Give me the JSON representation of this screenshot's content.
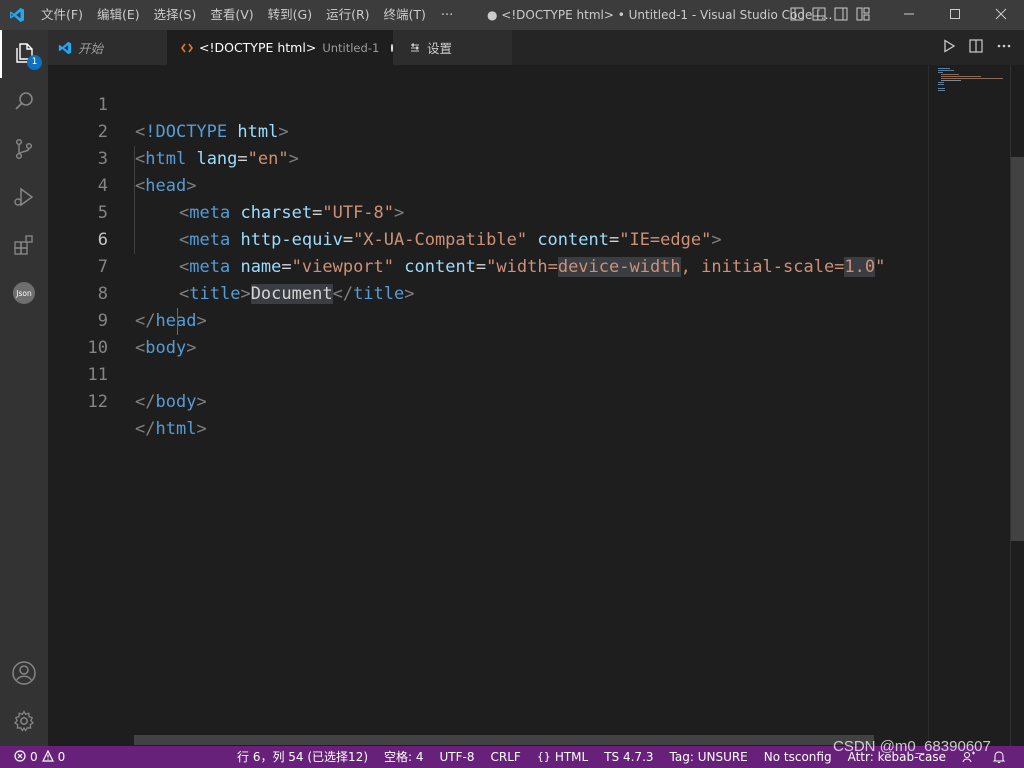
{
  "menu": [
    "文件(F)",
    "编辑(E)",
    "选择(S)",
    "查看(V)",
    "转到(G)",
    "运行(R)",
    "终端(T)"
  ],
  "menu_more": "···",
  "window_title": "● <!DOCTYPE html> • Untitled-1 - Visual Studio Code [...",
  "activity": {
    "explorer_badge": "1"
  },
  "tabs": [
    {
      "label": "开始",
      "icon": "vscode-icon"
    },
    {
      "label": "<!DOCTYPE html>",
      "description": "Untitled-1",
      "icon": "html-icon",
      "dirty": true
    },
    {
      "label": "设置",
      "icon": "settings-list-icon"
    }
  ],
  "editor": {
    "line_numbers": [
      "1",
      "2",
      "3",
      "4",
      "5",
      "6",
      "7",
      "8",
      "9",
      "10",
      "11",
      "12"
    ],
    "current_line": "6"
  },
  "code_tokens": {
    "l1": [
      "<",
      "!DOCTYPE",
      " ",
      "html",
      ">"
    ],
    "l2": [
      "<",
      "html",
      " ",
      "lang",
      "=",
      "\"en\"",
      ">"
    ],
    "l3": [
      "<",
      "head",
      ">"
    ],
    "l4": [
      "<",
      "meta",
      " ",
      "charset",
      "=",
      "\"UTF-8\"",
      ">"
    ],
    "l5": [
      "<",
      "meta",
      " ",
      "http-equiv",
      "=",
      "\"X-UA-Compatible\"",
      " ",
      "content",
      "=",
      "\"IE=edge\"",
      ">"
    ],
    "l6": [
      "<",
      "meta",
      " ",
      "name",
      "=",
      "\"viewport\"",
      " ",
      "content",
      "=",
      "\"width=",
      "device-width",
      ", initial-scale=",
      "1.0",
      "\""
    ],
    "l7": [
      "<",
      "title",
      ">",
      "Document",
      "</",
      "title",
      ">"
    ],
    "l8": [
      "</",
      "head",
      ">"
    ],
    "l9": [
      "<",
      "body",
      ">"
    ],
    "l11": [
      "</",
      "body",
      ">"
    ],
    "l12": [
      "</",
      "html",
      ">"
    ]
  },
  "statusbar": {
    "errors": "0",
    "warnings": "0",
    "position": "行 6，列 54 (已选择12)",
    "spaces": "空格: 4",
    "encoding": "UTF-8",
    "eol": "CRLF",
    "language": "HTML",
    "ts_version": "TS 4.7.3",
    "tag": "Tag: UNSURE",
    "tsconfig": "No tsconfig",
    "attr": "Attr: kebab-case"
  },
  "watermark": "CSDN @m0_68390607",
  "colors": {
    "statusbar": "#68217a",
    "editor_bg": "#1e1e1e",
    "tag": "#569cd6",
    "attr": "#9cdcfe",
    "string": "#ce9178"
  }
}
